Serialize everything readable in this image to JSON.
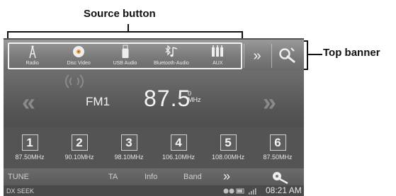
{
  "callouts": {
    "source_button": "Source button",
    "top_banner": "Top banner"
  },
  "sources": [
    {
      "label": "Radio",
      "icon": "radio-tower-icon"
    },
    {
      "label": "Disc Video",
      "icon": "disc-icon"
    },
    {
      "label": "USB Audio",
      "icon": "usb-icon"
    },
    {
      "label": "Bluetooth-Audio",
      "icon": "bluetooth-music-icon"
    },
    {
      "label": "AUX",
      "icon": "aux-plug-icon"
    }
  ],
  "banner": {
    "more_glyph": "»"
  },
  "tuner": {
    "band": "FM1",
    "frequency": "87.5",
    "frequency_decimal": "0",
    "unit": "MHz",
    "seek_left_glyph": "«",
    "seek_right_glyph": "»"
  },
  "presets": [
    {
      "number": "1",
      "freq": "87.50MHz"
    },
    {
      "number": "2",
      "freq": "90.10MHz"
    },
    {
      "number": "3",
      "freq": "98.10MHz"
    },
    {
      "number": "4",
      "freq": "106.10MHz"
    },
    {
      "number": "5",
      "freq": "108.00MHz"
    },
    {
      "number": "6",
      "freq": "87.50MHz"
    }
  ],
  "bottom_bar": {
    "tune": "TUNE",
    "ta": "TA",
    "info": "Info",
    "band": "Band",
    "more_glyph": "»"
  },
  "status": {
    "mode": "DX SEEK",
    "time": "08:21 AM"
  }
}
